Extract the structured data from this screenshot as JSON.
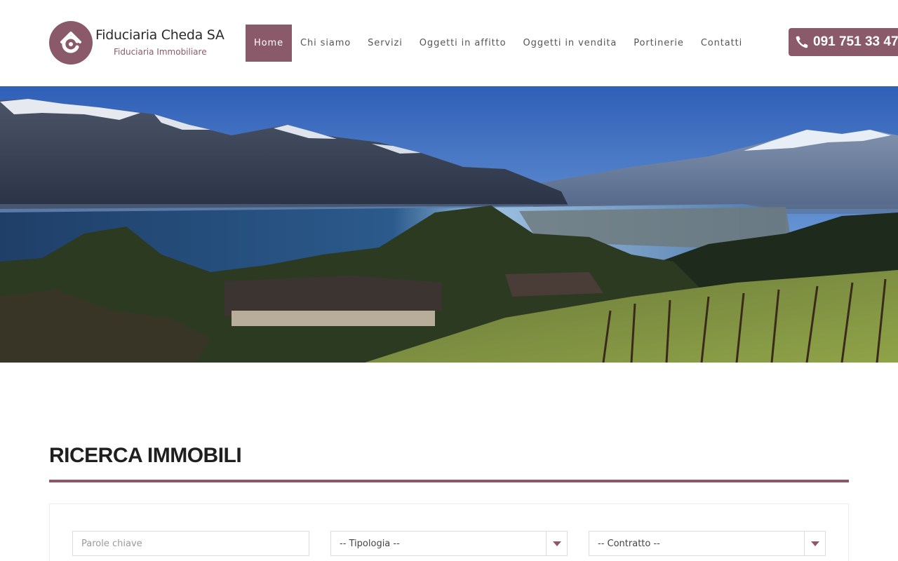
{
  "brand": {
    "name": "Fiduciaria Cheda SA",
    "tagline": "Fiduciaria Immobiliare",
    "accent_color": "#8a5a6a"
  },
  "nav": {
    "items": [
      {
        "label": "Home",
        "active": true
      },
      {
        "label": "Chi siamo",
        "active": false
      },
      {
        "label": "Servizi",
        "active": false
      },
      {
        "label": "Oggetti in affitto",
        "active": false
      },
      {
        "label": "Oggetti in vendita",
        "active": false
      },
      {
        "label": "Portinerie",
        "active": false
      },
      {
        "label": "Contatti",
        "active": false
      }
    ]
  },
  "phone": {
    "icon": "phone-icon",
    "number": "091 751 33 47"
  },
  "hero": {
    "image": "lake-mountains-panorama"
  },
  "search": {
    "title": "RICERCA IMMOBILI",
    "keywords_placeholder": "Parole chiave",
    "type_value": "-- Tipologia --",
    "contract_value": "-- Contratto --",
    "select_icon": "caret-down-icon"
  }
}
